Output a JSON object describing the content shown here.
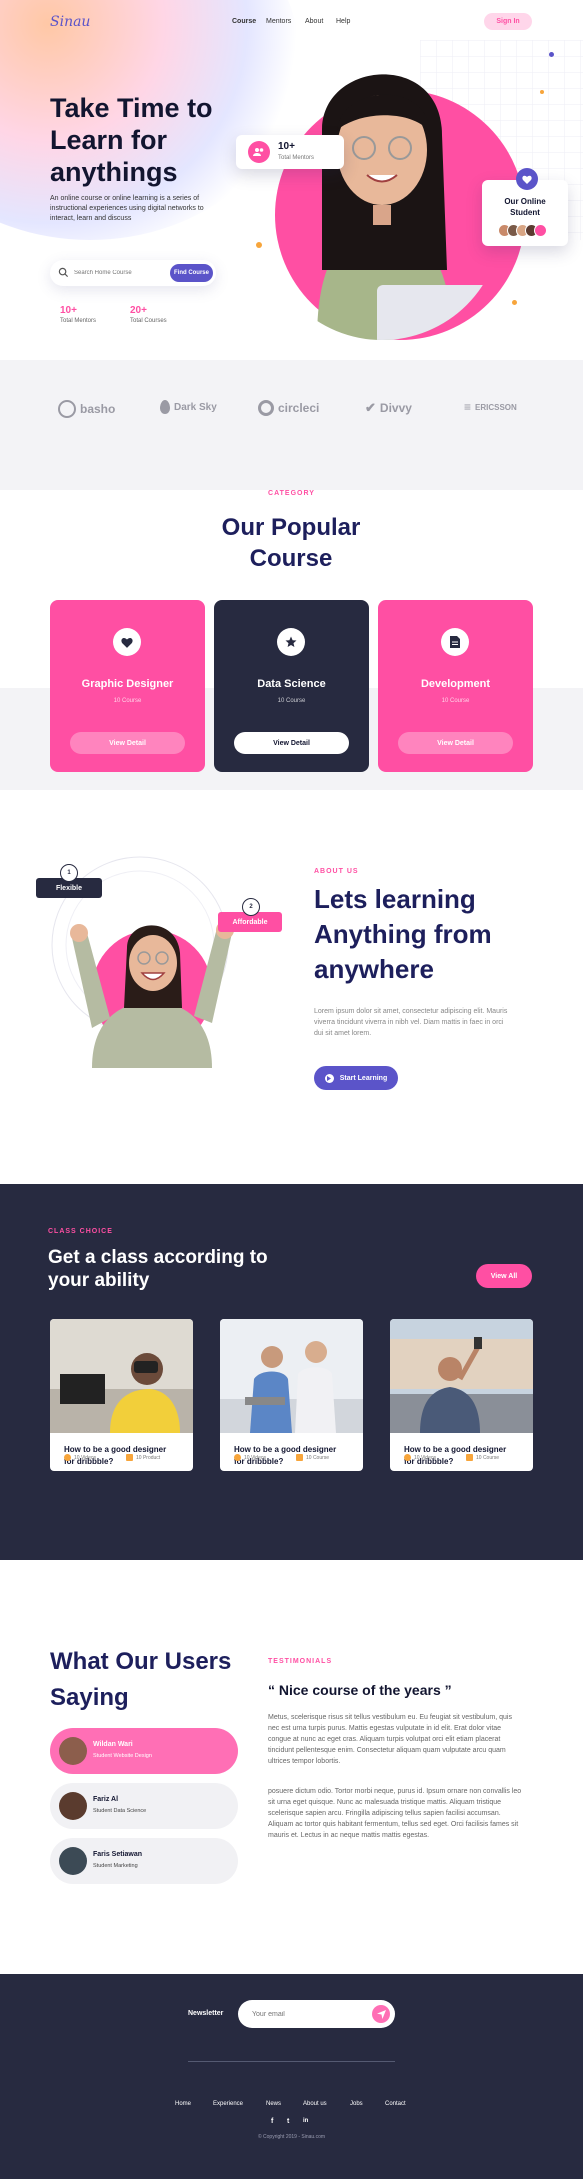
{
  "brand": {
    "logo": "Sinau"
  },
  "nav": {
    "links": [
      "Course",
      "Mentors",
      "About",
      "Help"
    ],
    "signin": "Sign In"
  },
  "hero": {
    "title": "Take Time to Learn for anythings",
    "description": "An online course or online learning is a series of instructional experiences using digital networks to interact, learn and discuss",
    "search_placeholder": "Search Home Course",
    "find_button": "Find Course",
    "stats": [
      {
        "value": "10+",
        "label": "Total Mentors"
      },
      {
        "value": "20+",
        "label": "Total Courses"
      }
    ],
    "mentor_card": {
      "value": "10+",
      "label": "Total Mentors"
    },
    "student_card": {
      "label": "Our Online Student"
    }
  },
  "partners": [
    "basho",
    "Dark Sky",
    "circleci",
    "Divvy",
    "ERICSSON"
  ],
  "courses": {
    "tag": "CATEGORY",
    "title": "Our Popular Course",
    "items": [
      {
        "title": "Graphic Designer",
        "count": "10 Course",
        "button": "View Detail"
      },
      {
        "title": "Data Science",
        "count": "10 Course",
        "button": "View Detail"
      },
      {
        "title": "Development",
        "count": "10 Course",
        "button": "View Detail"
      }
    ]
  },
  "about": {
    "tag": "ABOUT US",
    "title": "Lets learning Anything from anywhere",
    "text": "Lorem ipsum dolor sit amet, consectetur adipiscing elit. Mauris viverra tincidunt viverra in nibh vel. Diam mattis in faec in orci dui sit amet lorem.",
    "button": "Start Learning",
    "badge1": {
      "num": "1",
      "label": "Flexible"
    },
    "badge2": {
      "num": "2",
      "label": "Affordable"
    }
  },
  "classes": {
    "tag": "CLASS CHOICE",
    "title": "Get a class according to your ability",
    "view_all": "View All",
    "items": [
      {
        "title": "How to be a good designer for dribbble?",
        "videos": "10 Videos",
        "files": "10 Product"
      },
      {
        "title": "How to be a good designer for dribbble?",
        "videos": "10 Videos",
        "files": "10 Course"
      },
      {
        "title": "How to be a good designer for dribbble?",
        "videos": "10 Videos",
        "files": "10 Course"
      }
    ]
  },
  "testimonials": {
    "title": "What Our Users Saying",
    "tag": "TESTIMONIALS",
    "quote": "“ Nice course of the years ”",
    "p1": "Metus, scelerisque risus sit tellus vestibulum eu. Eu feugiat sit vestibulum, quis nec est urna turpis purus. Mattis egestas vulputate in id elit. Erat dolor vitae congue at nunc ac eget cras. Aliquam turpis volutpat orci elit etiam placerat tincidunt pellentesque enim. Consectetur aliquam quam vulputate arcu quam ultrices tempor lobortis.",
    "p2": "posuere dictum odio. Tortor morbi neque, purus id. Ipsum ornare non convallis leo sit urna eget quisque. Nunc ac malesuada tristique mattis. Aliquam tristique scelerisque sapien arcu. Fringilla adipiscing tellus sapien facilisi accumsan. Aliquam ac tortor quis habitant fermentum, tellus sed eget. Orci facilisis fames sit mauris et. Lectus in ac neque mattis mattis egestas.",
    "users": [
      {
        "name": "Wildan Wari",
        "role": "Student Website Design"
      },
      {
        "name": "Fariz Al",
        "role": "Student Data Science"
      },
      {
        "name": "Faris Setiawan",
        "role": "Student Marketing"
      }
    ]
  },
  "footer": {
    "newsletter_label": "Newsletter",
    "email_placeholder": "Your email",
    "links": [
      "Home",
      "Experience",
      "News",
      "About us",
      "Jobs",
      "Contact"
    ],
    "social": [
      "f",
      "t",
      "in"
    ],
    "copyright": "© Copyright 2019 - Sinau.com"
  },
  "colors": {
    "accent": "#ff4fa3",
    "primary": "#5b54c9",
    "navy": "#272a40",
    "title": "#1d1f5c"
  }
}
